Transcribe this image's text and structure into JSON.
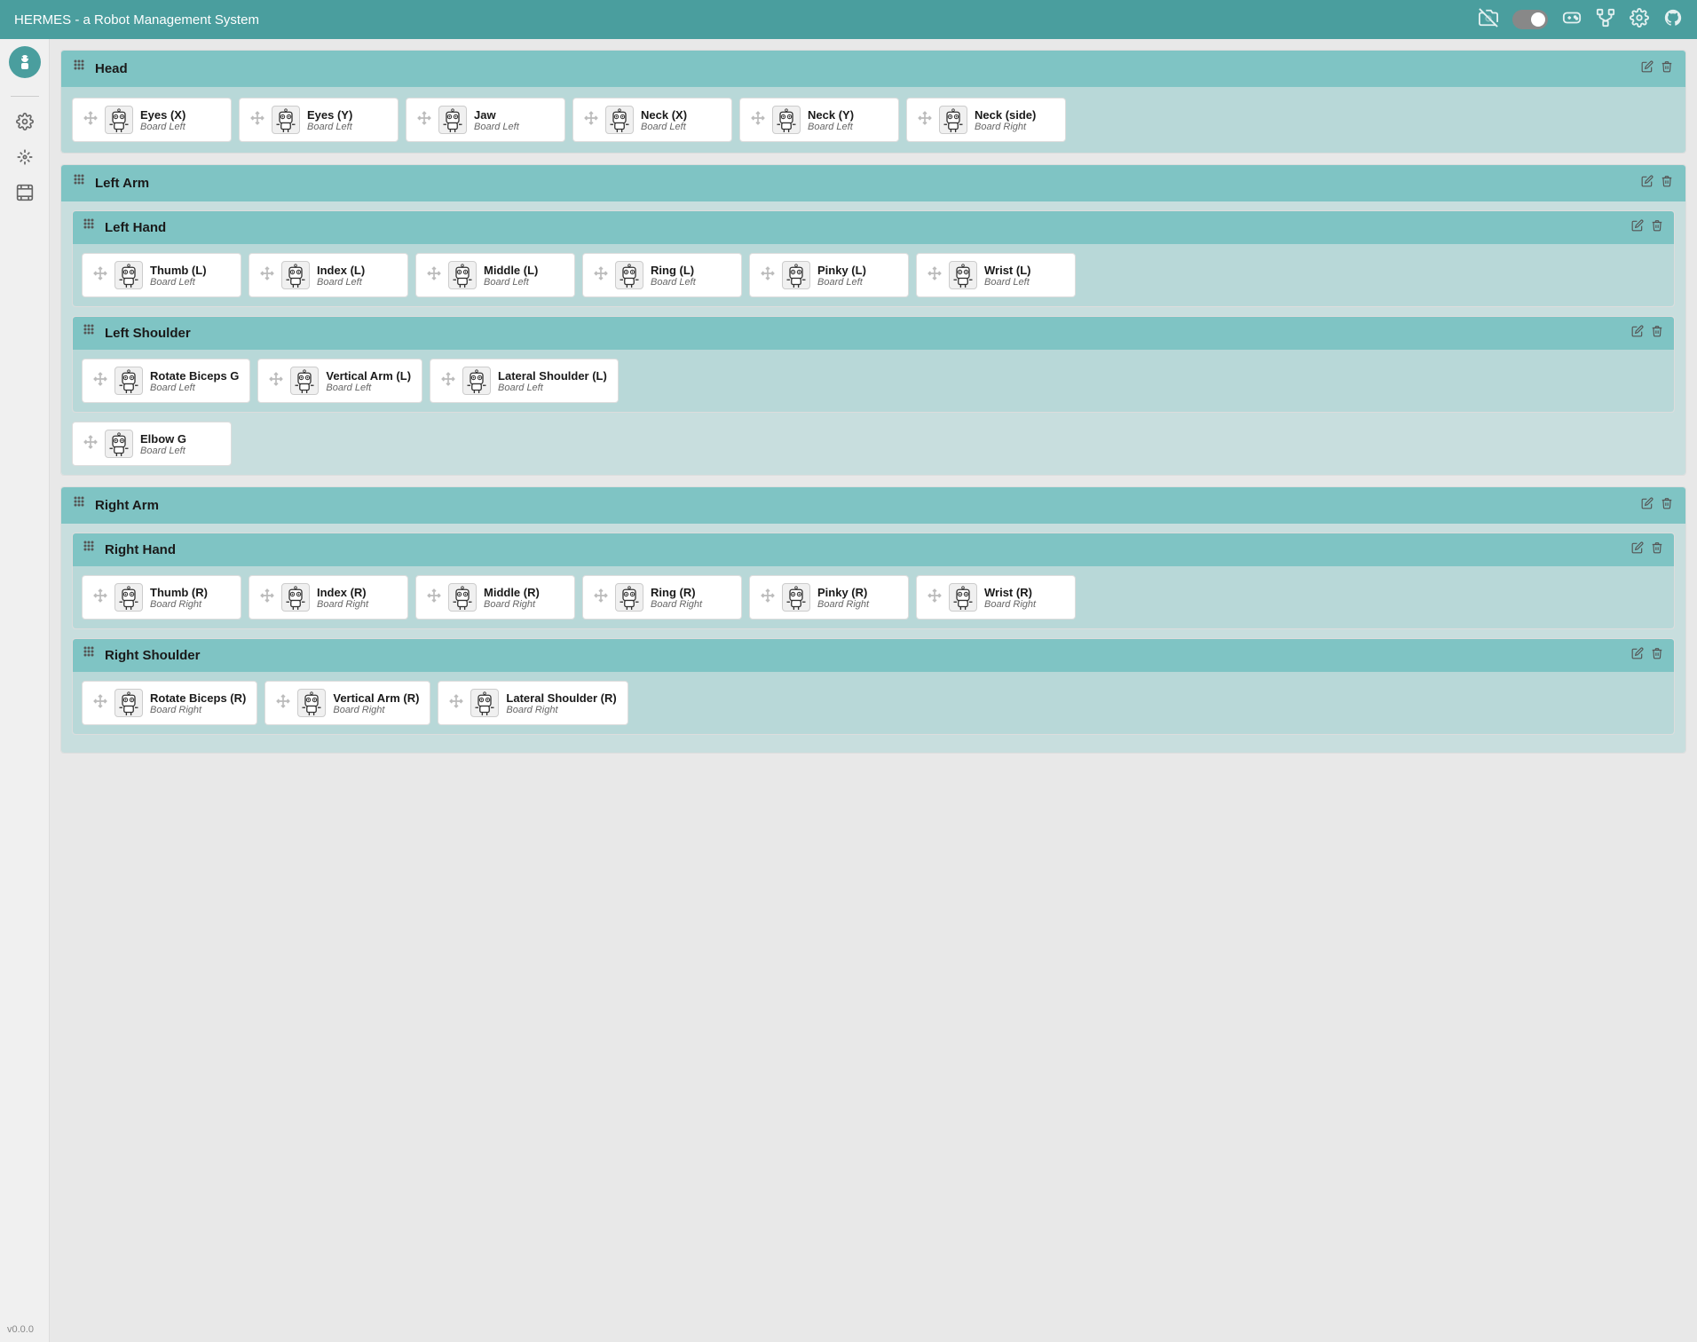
{
  "app": {
    "title": "HERMES - a Robot Management System",
    "version": "v0.0.0"
  },
  "navbar": {
    "icons": [
      "camera-off-icon",
      "toggle-icon",
      "gamepad-icon",
      "network-icon",
      "settings-icon",
      "github-icon"
    ]
  },
  "sidebar": {
    "icons": [
      "robot-avatar-icon",
      "gear-icon",
      "move-icon",
      "film-icon"
    ]
  },
  "sections": [
    {
      "id": "head",
      "label": "Head",
      "nested": false,
      "servos": [
        {
          "name": "Eyes (X)",
          "sub": "Board Left"
        },
        {
          "name": "Eyes (Y)",
          "sub": "Board Left"
        },
        {
          "name": "Jaw",
          "sub": "Board Left"
        },
        {
          "name": "Neck (X)",
          "sub": "Board Left"
        },
        {
          "name": "Neck (Y)",
          "sub": "Board Left"
        },
        {
          "name": "Neck (side)",
          "sub": "Board Right"
        }
      ]
    },
    {
      "id": "left-arm",
      "label": "Left Arm",
      "nested": true,
      "subsections": [
        {
          "id": "left-hand",
          "label": "Left Hand",
          "servos": [
            {
              "name": "Thumb (L)",
              "sub": "Board Left"
            },
            {
              "name": "Index (L)",
              "sub": "Board Left"
            },
            {
              "name": "Middle (L)",
              "sub": "Board Left"
            },
            {
              "name": "Ring (L)",
              "sub": "Board Left"
            },
            {
              "name": "Pinky (L)",
              "sub": "Board Left"
            },
            {
              "name": "Wrist (L)",
              "sub": "Board Left"
            }
          ]
        },
        {
          "id": "left-shoulder",
          "label": "Left Shoulder",
          "servos": [
            {
              "name": "Rotate Biceps G",
              "sub": "Board Left"
            },
            {
              "name": "Vertical Arm (L)",
              "sub": "Board Left"
            },
            {
              "name": "Lateral Shoulder (L)",
              "sub": "Board Left"
            }
          ]
        }
      ],
      "extra_servos": [
        {
          "name": "Elbow G",
          "sub": "Board Left"
        }
      ]
    },
    {
      "id": "right-arm",
      "label": "Right Arm",
      "nested": true,
      "subsections": [
        {
          "id": "right-hand",
          "label": "Right Hand",
          "servos": [
            {
              "name": "Thumb (R)",
              "sub": "Board Right"
            },
            {
              "name": "Index (R)",
              "sub": "Board Right"
            },
            {
              "name": "Middle (R)",
              "sub": "Board Right"
            },
            {
              "name": "Ring (R)",
              "sub": "Board Right"
            },
            {
              "name": "Pinky (R)",
              "sub": "Board Right"
            },
            {
              "name": "Wrist (R)",
              "sub": "Board Right"
            }
          ]
        },
        {
          "id": "right-shoulder",
          "label": "Right Shoulder",
          "servos": [
            {
              "name": "Rotate Biceps (R)",
              "sub": "Board Right"
            },
            {
              "name": "Vertical Arm (R)",
              "sub": "Board Right"
            },
            {
              "name": "Lateral Shoulder (R)",
              "sub": "Board Right"
            }
          ]
        }
      ],
      "extra_servos": []
    }
  ]
}
